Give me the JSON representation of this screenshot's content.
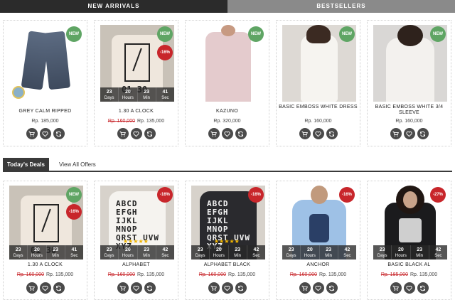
{
  "tabs": [
    {
      "label": "NEW ARRIVALS"
    },
    {
      "label": "BESTSELLERS"
    }
  ],
  "badge_text": {
    "new": "NEW"
  },
  "countdown_labels": [
    "Days",
    "Hours",
    "Min",
    "Sec"
  ],
  "deals": {
    "label": "Today's Deals",
    "link": "View All Offers"
  },
  "row1": [
    {
      "name": "GREY CALM RIPPED",
      "old_price": "",
      "price": "Rp. 185,000",
      "new": true,
      "sale": "",
      "countdown": null
    },
    {
      "name": "1.30 A CLOCK",
      "old_price": "Rp. 160,000",
      "price": "Rp. 135,000",
      "new": true,
      "sale": "-16%",
      "countdown": [
        "23",
        "20",
        "23",
        "41"
      ]
    },
    {
      "name": "KAZUNO",
      "old_price": "",
      "price": "Rp. 320,000",
      "new": true,
      "sale": "",
      "countdown": null
    },
    {
      "name": "BASIC EMBOSS WHITE DRESS",
      "old_price": "",
      "price": "Rp. 160,000",
      "new": true,
      "sale": "",
      "countdown": null
    },
    {
      "name": "BASIC EMBOSS WHITE 3/4 SLEEVE",
      "old_price": "",
      "price": "Rp. 160,000",
      "new": true,
      "sale": "",
      "countdown": null
    }
  ],
  "row2": [
    {
      "name": "1.30 A CLOCK",
      "old_price": "Rp. 160,000",
      "price": "Rp. 135,000",
      "new": true,
      "sale": "-16%",
      "countdown": [
        "23",
        "20",
        "23",
        "41"
      ],
      "rating": 0
    },
    {
      "name": "ALPHABET",
      "old_price": "Rp. 160,000",
      "price": "Rp. 135,000",
      "new": false,
      "sale": "-16%",
      "countdown": [
        "23",
        "20",
        "23",
        "42"
      ],
      "rating": 5
    },
    {
      "name": "ALPHABET BLACK",
      "old_price": "Rp. 160,000",
      "price": "Rp. 135,000",
      "new": false,
      "sale": "-16%",
      "countdown": [
        "23",
        "20",
        "23",
        "42"
      ],
      "rating": 5
    },
    {
      "name": "ANCHOR",
      "old_price": "Rp. 160,000",
      "price": "Rp. 135,000",
      "new": false,
      "sale": "-16%",
      "countdown": [
        "23",
        "20",
        "23",
        "42"
      ],
      "rating": 0
    },
    {
      "name": "BASIC BLACK AL",
      "old_price": "Rp. 185,000",
      "price": "Rp. 135,000",
      "new": false,
      "sale": "-27%",
      "countdown": [
        "23",
        "20",
        "23",
        "42"
      ],
      "rating": 0
    }
  ],
  "photo_text": {
    "clock_print": "01 30",
    "alphabet_print": "ABCD EFGH IJKL MNOP QRST UVW XYZ"
  },
  "icons": [
    "cart-icon",
    "heart-icon",
    "compare-icon"
  ],
  "colors": {
    "tab_active": "#2b2b2b",
    "tab_inactive": "#8a8a8a",
    "new_badge": "#5fa564",
    "sale_badge": "#c8262b",
    "old_price": "#c8262b"
  }
}
